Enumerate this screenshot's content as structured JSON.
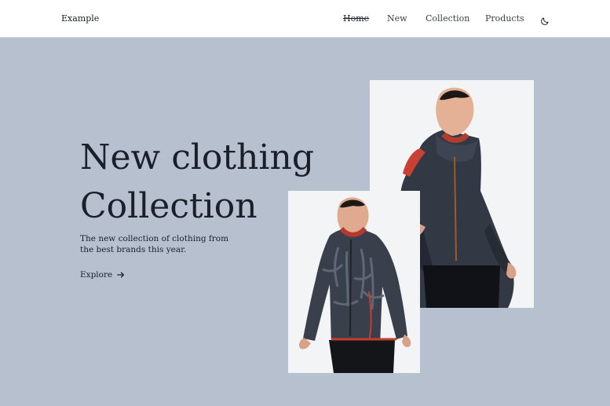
{
  "header": {
    "brand": "Example",
    "nav": [
      {
        "label": "Home",
        "active": true
      },
      {
        "label": "New"
      },
      {
        "label": "Collection"
      },
      {
        "label": "Products"
      }
    ],
    "theme_toggle_icon": "moon-icon"
  },
  "hero": {
    "title_line1": "New clothing",
    "title_line2": "Collection",
    "description_line1": "The new collection of clothing from",
    "description_line2": "the best brands this year.",
    "cta_label": "Explore",
    "cta_icon": "arrow-right-icon"
  },
  "images": [
    {
      "name": "man in dark technical jacket",
      "icon": "product-photo"
    },
    {
      "name": "man in camouflage puffer jacket",
      "icon": "product-photo"
    }
  ],
  "colors": {
    "background": "#b7c0cf",
    "header_bg": "#ffffff",
    "text": "#1b1f2a"
  }
}
